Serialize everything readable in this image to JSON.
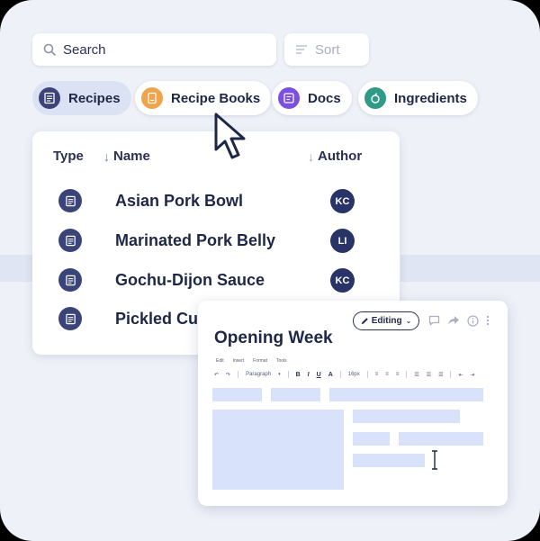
{
  "search": {
    "placeholder": "Search"
  },
  "sort": {
    "label": "Sort"
  },
  "tabs": [
    {
      "label": "Recipes",
      "icon": "document-icon",
      "color": "#3a4478",
      "active": true
    },
    {
      "label": "Recipe Books",
      "icon": "book-icon",
      "color": "#f0a34a",
      "active": false
    },
    {
      "label": "Docs",
      "icon": "docs-icon",
      "color": "#7b4fe0",
      "active": false
    },
    {
      "label": "Ingredients",
      "icon": "apple-icon",
      "color": "#2f9a86",
      "active": false
    }
  ],
  "list": {
    "columns": {
      "type": "Type",
      "name": "Name",
      "author": "Author"
    },
    "rows": [
      {
        "name": "Asian Pork Bowl",
        "author": "KC"
      },
      {
        "name": "Marinated Pork Belly",
        "author": "LI"
      },
      {
        "name": "Gochu-Dijon Sauce",
        "author": "KC"
      },
      {
        "name": "Pickled Cu",
        "author": ""
      }
    ]
  },
  "editor": {
    "title": "Opening Week",
    "mode": "Editing",
    "menu": [
      "Edit",
      "Insert",
      "Format",
      "Tools"
    ],
    "toolbar": {
      "style": "Paragraph",
      "size": "16px",
      "bold": "B",
      "italic": "I",
      "underline": "U",
      "color": "A"
    }
  },
  "colors": {
    "background": "#eef1f8",
    "accent": "#3a4478",
    "placeholder": "#d8e2fb"
  }
}
